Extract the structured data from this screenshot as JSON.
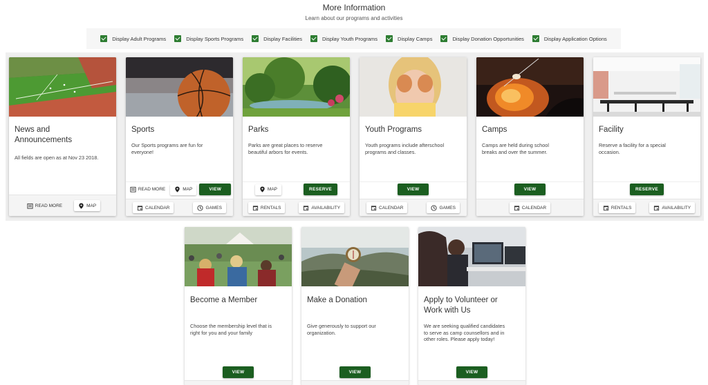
{
  "header": {
    "title": "More Information",
    "subtitle": "Learn about our programs and activities"
  },
  "filters": [
    {
      "label": "Display Adult Programs",
      "checked": true
    },
    {
      "label": "Display Sports Programs",
      "checked": true
    },
    {
      "label": "Display Facilities",
      "checked": true
    },
    {
      "label": "Display Youth Programs",
      "checked": true
    },
    {
      "label": "Display Camps",
      "checked": true
    },
    {
      "label": "Display Donation Opportunities",
      "checked": true
    },
    {
      "label": "Display Application Options",
      "checked": true
    }
  ],
  "colors": {
    "accent": "#1b5e20",
    "checkbox": "#2e7d32",
    "band": "#efefef"
  },
  "cards": {
    "news": {
      "title": "News and Announcements",
      "text": "All fields are open as at Nov 23 2018.",
      "read_more": "READ MORE",
      "map": "MAP"
    },
    "sports": {
      "title": "Sports",
      "text": "Our Sports programs are fun for everyone!",
      "read_more": "READ MORE",
      "map": "MAP",
      "view": "VIEW",
      "calendar": "CALENDAR",
      "games": "GAMES"
    },
    "parks": {
      "title": "Parks",
      "text": "Parks are great places to reserve beautiful arbors for events.",
      "map": "MAP",
      "reserve": "RESERVE",
      "rentals": "RENTALS",
      "availability": "AVAILABILITY"
    },
    "youth": {
      "title": "Youth Programs",
      "text": "Youth programs include afterschool programs and classes.",
      "view": "VIEW",
      "calendar": "CALENDAR",
      "games": "GAMES"
    },
    "camps": {
      "title": "Camps",
      "text": "Camps are held during school breaks and over the summer.",
      "view": "VIEW",
      "calendar": "CALENDAR"
    },
    "facility": {
      "title": "Facility",
      "text": "Reserve a facility for a special occasion.",
      "reserve": "RESERVE",
      "rentals": "RENTALS",
      "availability": "AVAILABILITY"
    },
    "member": {
      "title": "Become a Member",
      "text": "Choose the membership level that is right for you and your family",
      "view": "VIEW"
    },
    "donation": {
      "title": "Make a Donation",
      "text": "Give generously to support our organization.",
      "view": "VIEW"
    },
    "volunteer": {
      "title": "Apply to Volunteer or Work with Us",
      "text": "We are seeking qualified candidates to serve as camp counsellors and in other roles. Please apply today!",
      "view": "VIEW"
    }
  }
}
